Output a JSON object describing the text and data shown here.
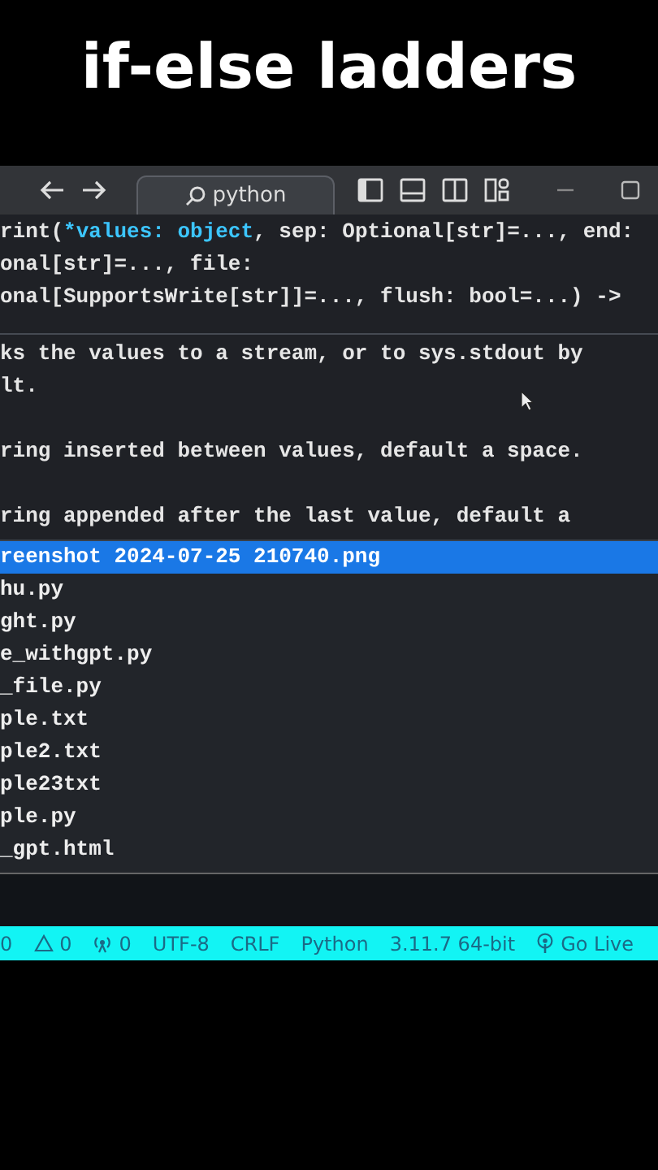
{
  "caption": "if-else ladders",
  "title_bar": {
    "search": "python"
  },
  "hover": {
    "signature": [
      {
        "parts": [
          {
            "text": "rint(",
            "kind": "plain"
          },
          {
            "text": "*values: object",
            "kind": "param"
          },
          {
            "text": ", sep: Optional[str]=..., end:",
            "kind": "plain"
          }
        ]
      },
      {
        "parts": [
          {
            "text": "onal[str]=..., file:",
            "kind": "plain"
          }
        ]
      },
      {
        "parts": [
          {
            "text": "onal[SupportsWrite[str]]=..., flush: bool=...) ->",
            "kind": "plain"
          }
        ]
      }
    ],
    "doc": [
      {
        "lines": [
          "ks the values to a stream, or to sys.stdout by",
          "lt."
        ]
      },
      {
        "lines": [
          "ring inserted between values, default a space."
        ]
      },
      {
        "lines": [
          "ring appended after the last value, default a"
        ]
      }
    ]
  },
  "file_list": [
    {
      "name": "reenshot 2024-07-25 210740.png",
      "selected": true
    },
    {
      "name": "hu.py",
      "selected": false
    },
    {
      "name": "ght.py",
      "selected": false
    },
    {
      "name": "e_withgpt.py",
      "selected": false
    },
    {
      "name": "_file.py",
      "selected": false
    },
    {
      "name": "ple.txt",
      "selected": false
    },
    {
      "name": "ple2.txt",
      "selected": false
    },
    {
      "name": "ple23txt",
      "selected": false
    },
    {
      "name": "ple.py",
      "selected": false
    },
    {
      "name": "_gpt.html",
      "selected": false
    }
  ],
  "status_bar": [
    {
      "kind": "text",
      "text": "0"
    },
    {
      "kind": "warning",
      "text": "0"
    },
    {
      "kind": "ports",
      "text": "0"
    },
    {
      "kind": "text",
      "text": "UTF-8"
    },
    {
      "kind": "text",
      "text": "CRLF"
    },
    {
      "kind": "text",
      "text": "Python"
    },
    {
      "kind": "text",
      "text": "3.11.7 64-bit"
    },
    {
      "kind": "live",
      "text": "Go Live"
    }
  ]
}
